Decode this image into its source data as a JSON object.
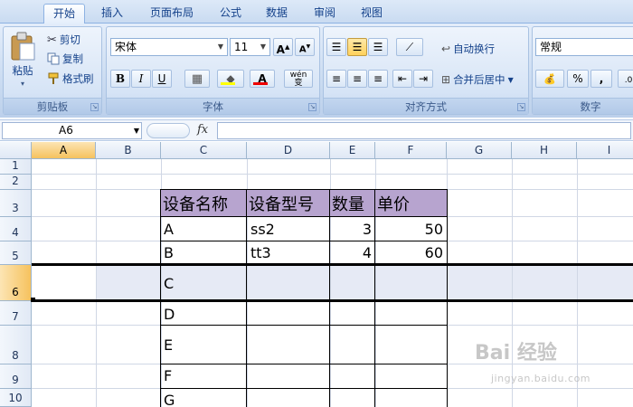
{
  "tabs": [
    "开始",
    "插入",
    "页面布局",
    "公式",
    "数据",
    "审阅",
    "视图"
  ],
  "active_tab": "开始",
  "clipboard": {
    "paste": "粘贴",
    "cut": "剪切",
    "copy": "复制",
    "format_painter": "格式刷",
    "label": "剪贴板"
  },
  "font": {
    "name": "宋体",
    "size": "11",
    "bold": "B",
    "italic": "I",
    "underline": "U",
    "label": "字体",
    "grow": "A",
    "shrink": "A",
    "wen": "wén\n变"
  },
  "alignment": {
    "wrap": "自动换行",
    "merge": "合并后居中",
    "label": "对齐方式"
  },
  "number": {
    "format": "常规",
    "percent": "%",
    "comma": ",",
    "label": "数字"
  },
  "formula_bar": {
    "name_box": "A6",
    "fx": "fx",
    "value": ""
  },
  "columns": [
    "A",
    "B",
    "C",
    "D",
    "E",
    "F",
    "G",
    "H",
    "I"
  ],
  "selected_column": "A",
  "rows": [
    "1",
    "2",
    "3",
    "4",
    "5",
    "6",
    "7",
    "8",
    "9",
    "10"
  ],
  "selected_row": "6",
  "table": {
    "headers": [
      "设备名称",
      "设备型号",
      "数量",
      "单价"
    ],
    "data": [
      {
        "name": "A",
        "model": "ss2",
        "qty": "3",
        "price": "50"
      },
      {
        "name": "B",
        "model": "tt3",
        "qty": "4",
        "price": "60"
      },
      {
        "name": "C",
        "model": "",
        "qty": "",
        "price": ""
      },
      {
        "name": "D",
        "model": "",
        "qty": "",
        "price": ""
      },
      {
        "name": "E",
        "model": "",
        "qty": "",
        "price": ""
      },
      {
        "name": "F",
        "model": "",
        "qty": "",
        "price": ""
      },
      {
        "name": "G",
        "model": "",
        "qty": "",
        "price": ""
      }
    ]
  },
  "watermark": {
    "main": "Bai 经验",
    "sub": "jingyan.baidu.com"
  },
  "colors": {
    "header_fill": "#b7a4cf",
    "selected_row_fill": "#e6eaf5",
    "selected_header": "#f6c25e"
  }
}
